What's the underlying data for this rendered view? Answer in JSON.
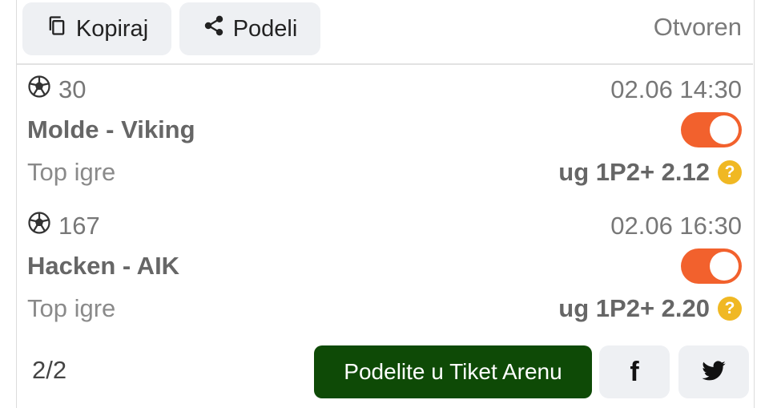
{
  "header": {
    "copy_label": "Kopiraj",
    "share_label": "Podeli",
    "status": "Otvoren"
  },
  "matches": [
    {
      "sport_icon": "soccer-ball-icon",
      "code": "30",
      "datetime": "02.06 14:30",
      "teams": "Molde - Viking",
      "toggle_on": true,
      "category": "Top igre",
      "pick": "ug 1P2+ 2.12"
    },
    {
      "sport_icon": "soccer-ball-icon",
      "code": "167",
      "datetime": "02.06 16:30",
      "teams": "Hacken - AIK",
      "toggle_on": true,
      "category": "Top igre",
      "pick": "ug 1P2+ 2.20"
    }
  ],
  "footer": {
    "count": "2/2",
    "arena_label": "Podelite u Tiket Arenu",
    "facebook_icon": "facebook-icon",
    "twitter_icon": "twitter-icon"
  },
  "colors": {
    "toggle_on": "#f2612d",
    "arena_button": "#0e4a06",
    "help_badge": "#f0b823",
    "light_button": "#eef0f3"
  }
}
